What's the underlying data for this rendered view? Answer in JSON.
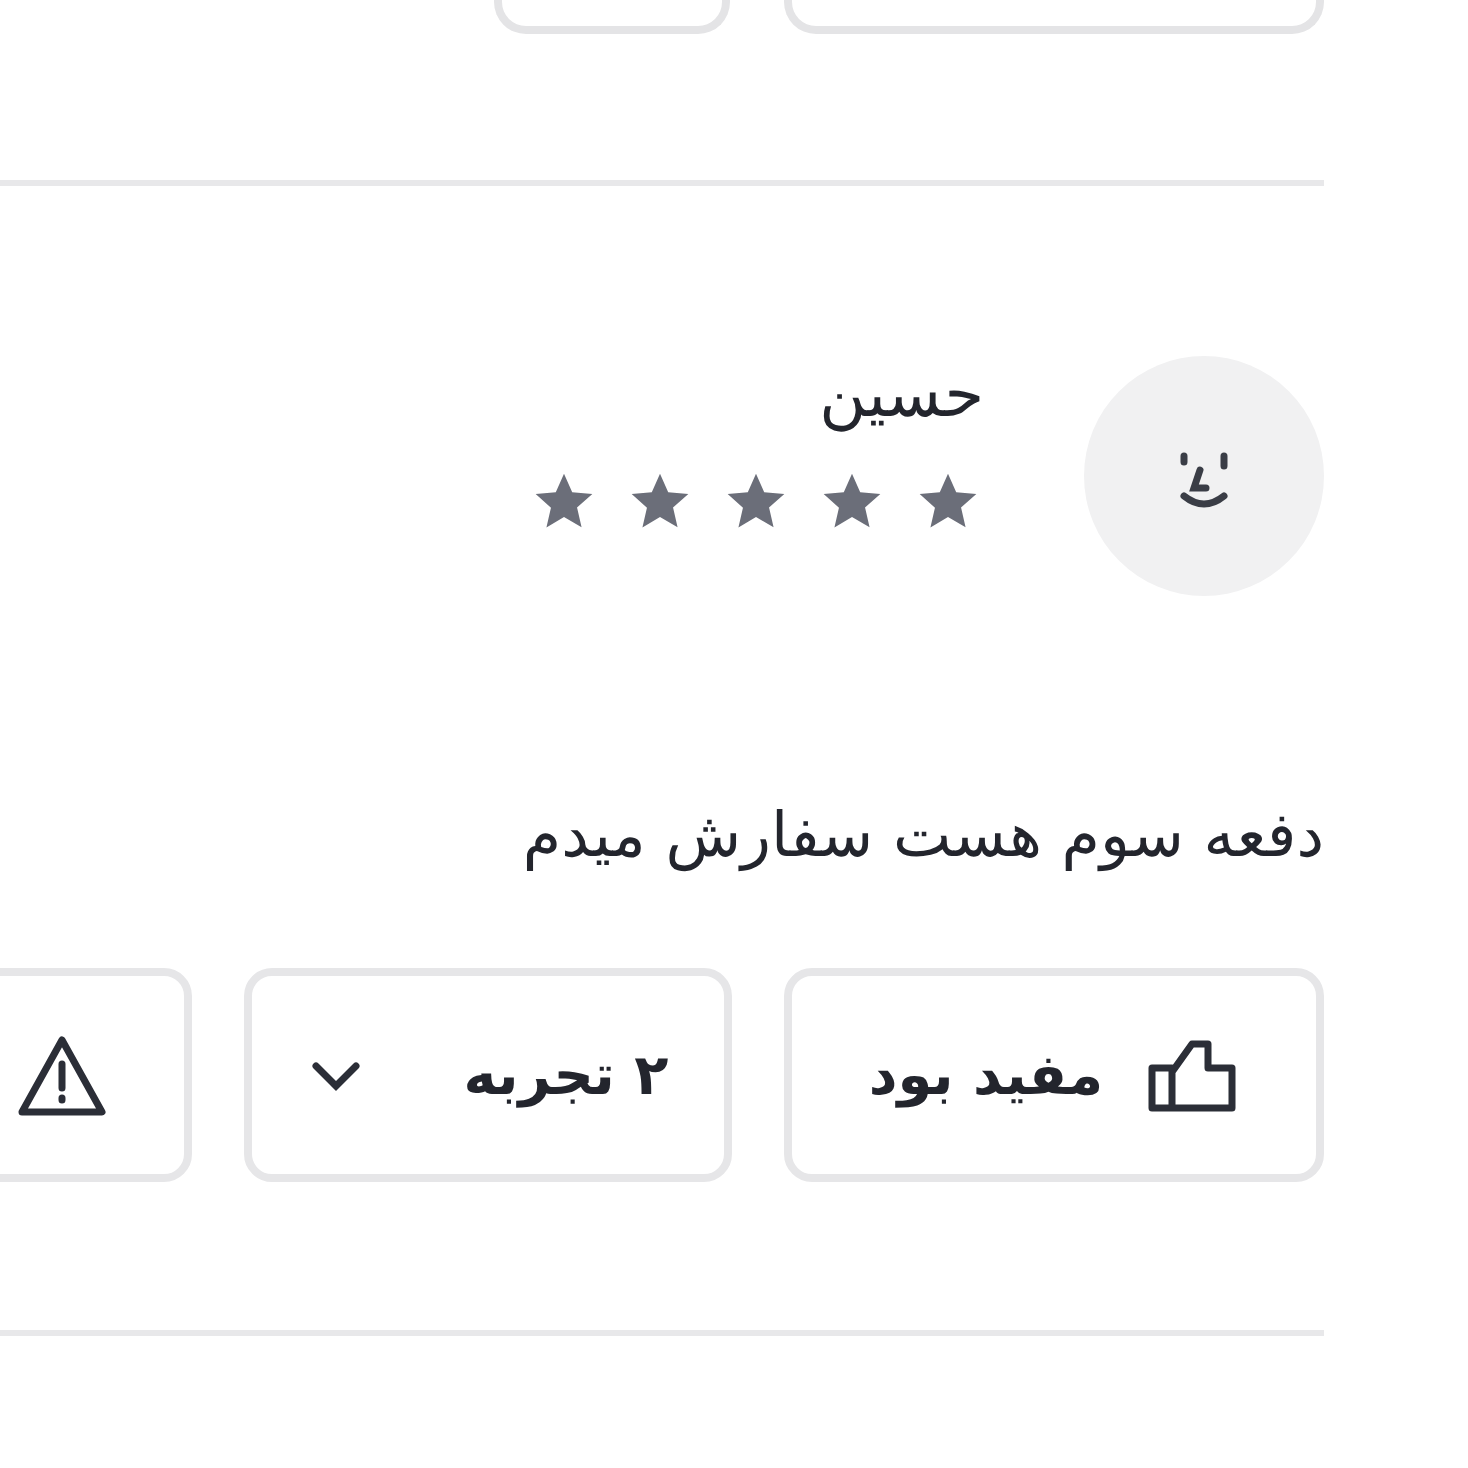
{
  "review": {
    "author": "حسین",
    "stars": 5,
    "comment": "دفعه سوم هست سفارش میدم"
  },
  "actions": [
    {
      "kind": "helpful",
      "label": "مفید بود"
    },
    {
      "kind": "experience",
      "label": "۲ تجربه",
      "expanded": false
    },
    {
      "kind": "report"
    }
  ]
}
